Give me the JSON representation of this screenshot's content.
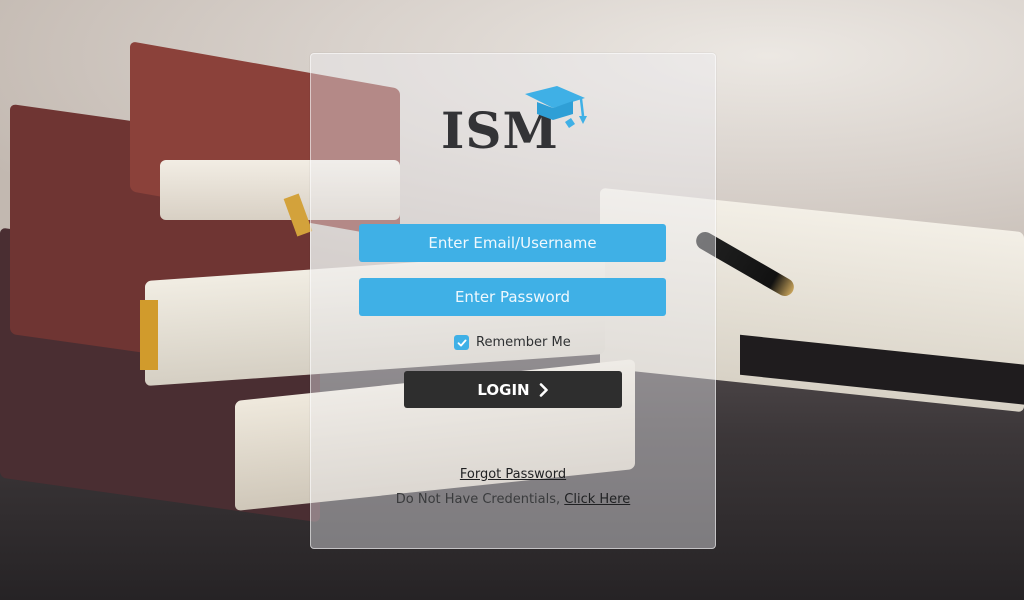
{
  "logo": {
    "text": "ISM",
    "icon": "graduation-cap-icon",
    "text_color": "#333336",
    "accent": "#3fb0e6"
  },
  "form": {
    "email_placeholder": "Enter Email/Username",
    "email_value": "",
    "password_placeholder": "Enter Password",
    "password_value": "",
    "remember_label": "Remember Me",
    "remember_checked": true,
    "login_label": "LOGIN",
    "login_icon": "chevron-right-icon",
    "field_color": "#3fb0e6",
    "button_color": "#2e2e2e"
  },
  "links": {
    "forgot_password": "Forgot Password",
    "no_credentials_prefix": "Do Not Have Credentials, ",
    "click_here": "Click Here"
  }
}
